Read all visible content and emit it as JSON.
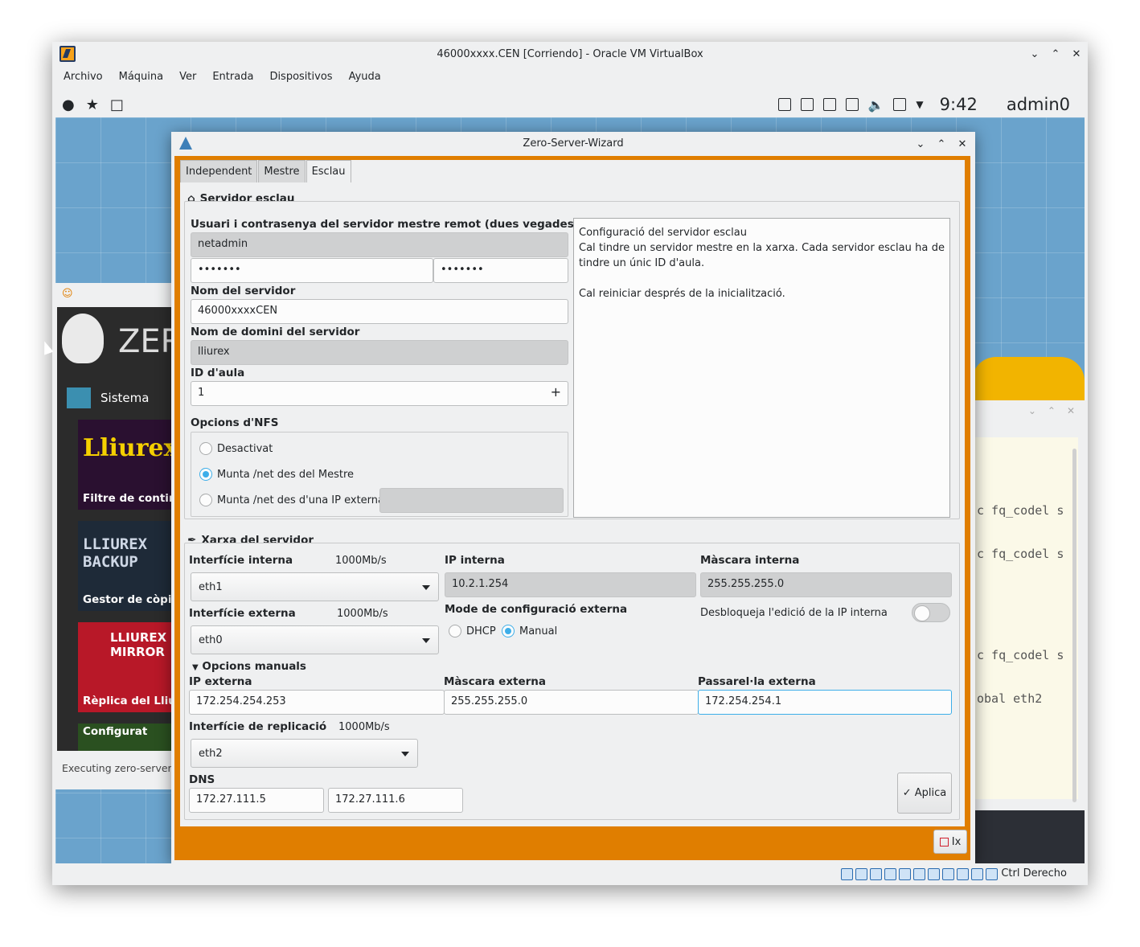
{
  "vbox": {
    "title": "46000xxxx.CEN [Corriendo] - Oracle VM VirtualBox",
    "menu": [
      "Archivo",
      "Máquina",
      "Ver",
      "Entrada",
      "Dispositivos",
      "Ayuda"
    ],
    "host_key": "Ctrl Derecho"
  },
  "guest_panel": {
    "clock": "9:42",
    "user": "admin0"
  },
  "zero_center": {
    "brand": "ZER",
    "category": "Sistema",
    "cards": [
      {
        "big": "Lliurex",
        "label": "Filtre de conting"
      },
      {
        "big": "LLIUREX BACKUP",
        "label": "Gestor de còpie"
      },
      {
        "big": "LLIUREX MIRROR",
        "label": "Rèplica del Lliur"
      },
      {
        "big": "",
        "label": "Configurat"
      }
    ],
    "status": "Executing zero-server-"
  },
  "terminal": {
    "lines": [
      "c fq_codel s",
      "c fq_codel s",
      "c fq_codel s",
      "obal eth2"
    ]
  },
  "wizard": {
    "title": "Zero-Server-Wizard",
    "tabs": [
      "Independent",
      "Mestre",
      "Esclau"
    ],
    "slave_section": "Servidor esclau",
    "credentials_label": "Usuari i contrasenya del servidor mestre remot (dues vegades)",
    "username": "netadmin",
    "password1": "•••••••",
    "password2": "•••••••",
    "server_name_label": "Nom del servidor",
    "server_name": "46000xxxxCEN",
    "domain_label": "Nom de domini del servidor",
    "domain": "lliurex",
    "classroom_label": "ID d'aula",
    "classroom_id": "1",
    "nfs_label": "Opcions d'NFS",
    "nfs_options": [
      "Desactivat",
      "Munta /net des del Mestre",
      "Munta /net des d'una IP externa"
    ],
    "info_lines": [
      "Configuració del servidor esclau",
      "Cal tindre un servidor mestre en la xarxa. Cada servidor esclau ha de tindre un únic ID d'aula.",
      "",
      "Cal reiniciar després de la inicialització."
    ],
    "network_section": "Xarxa del servidor",
    "internal_iface_label": "Interfície interna",
    "internal_speed": "1000Mb/s",
    "internal_iface": "eth1",
    "internal_ip_label": "IP interna",
    "internal_ip": "10.2.1.254",
    "internal_mask_label": "Màscara interna",
    "internal_mask": "255.255.255.0",
    "external_iface_label": "Interfície externa",
    "external_speed": "1000Mb/s",
    "external_iface": "eth0",
    "ext_mode_label": "Mode de configuració externa",
    "mode_dhcp": "DHCP",
    "mode_manual": "Manual",
    "unlock_label": "Desbloqueja l'edició de la IP interna",
    "manual_options": "Opcions manuals",
    "ext_ip_label": "IP externa",
    "ext_ip": "172.254.254.253",
    "ext_mask_label": "Màscara externa",
    "ext_mask": "255.255.255.0",
    "gateway_label": "Passarel·la externa",
    "gateway": "172.254.254.1",
    "repl_iface_label": "Interfície de replicació",
    "repl_speed": "1000Mb/s",
    "repl_iface": "eth2",
    "dns_label": "DNS",
    "dns1": "172.27.111.5",
    "dns2": "172.27.111.6",
    "apply": "Aplica",
    "exit": "Ix"
  }
}
